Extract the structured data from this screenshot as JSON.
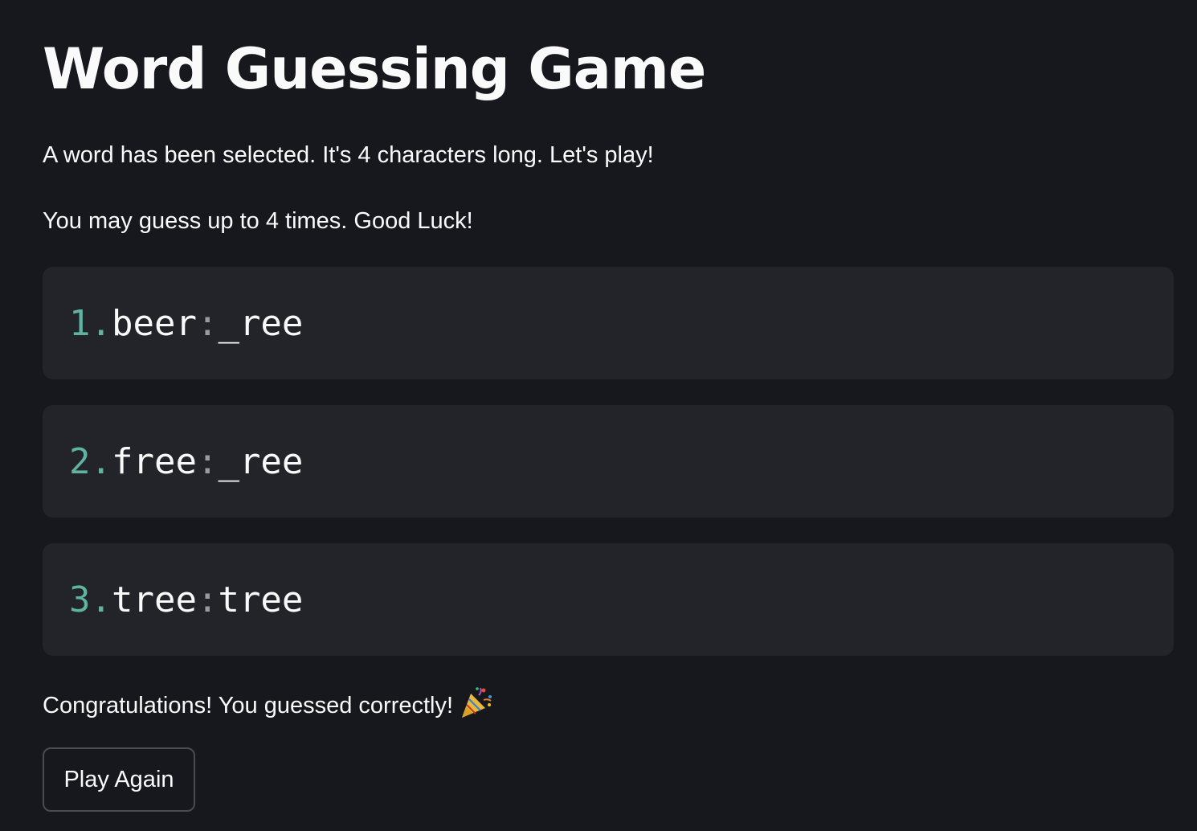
{
  "title": "Word Guessing Game",
  "intro": {
    "line1": "A word has been selected. It's 4 characters long. Let's play!",
    "line2": "You may guess up to 4 times. Good Luck!"
  },
  "guesses": [
    {
      "number": "1.",
      "word": "beer",
      "separator": ":",
      "result": "_ree"
    },
    {
      "number": "2.",
      "word": "free",
      "separator": ":",
      "result": "_ree"
    },
    {
      "number": "3.",
      "word": "tree",
      "separator": ":",
      "result": "tree"
    }
  ],
  "congrats": {
    "text": "Congratulations! You guessed correctly!",
    "icon": "party-popper-icon"
  },
  "play_again_label": "Play Again",
  "colors": {
    "background": "#17181d",
    "code_block": "#23242a",
    "number_accent": "#5fb3a1",
    "text": "#fafafa"
  }
}
